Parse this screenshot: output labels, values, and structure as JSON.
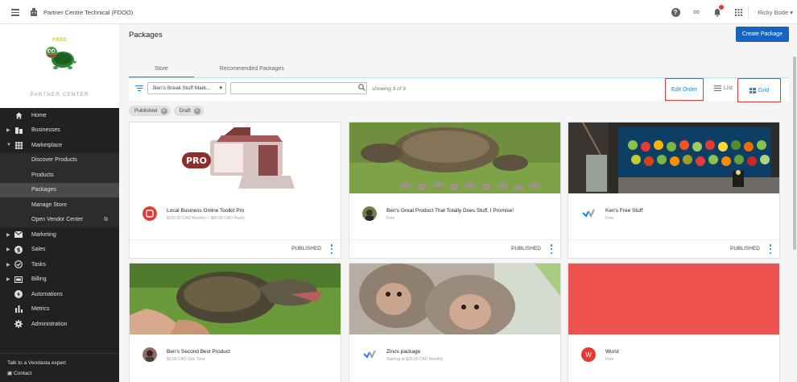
{
  "topbar": {
    "org_name": "Partner Centre Technical (FDOO)",
    "user_name": "Ricky Bode ▾",
    "icons": [
      "menu-icon",
      "building-icon",
      "help-icon",
      "infinity-icon",
      "bell-icon",
      "apps-icon"
    ]
  },
  "sidebar": {
    "partner_center": "PARTNER CENTER",
    "items": [
      {
        "label": "Home",
        "icon": "home-icon"
      },
      {
        "label": "Businesses",
        "icon": "business-icon"
      },
      {
        "label": "Marketplace",
        "icon": "grid-icon"
      },
      {
        "label": "Discover Products"
      },
      {
        "label": "Products"
      },
      {
        "label": "Packages"
      },
      {
        "label": "Manage Store"
      },
      {
        "label": "Open Vendor Center"
      },
      {
        "label": "Marketing",
        "icon": "mail-icon"
      },
      {
        "label": "Sales",
        "icon": "dollar-icon"
      },
      {
        "label": "Tasks",
        "icon": "check-icon"
      },
      {
        "label": "Billing",
        "icon": "billing-icon"
      },
      {
        "label": "Automations",
        "icon": "bolt-icon"
      },
      {
        "label": "Metrics",
        "icon": "bar-chart-icon"
      },
      {
        "label": "Administration",
        "icon": "gear-icon"
      }
    ],
    "talk": "Talk to a Vendasta expert",
    "contact": "Contact"
  },
  "main": {
    "title": "Packages",
    "create_button": "Create Package",
    "tabs": [
      {
        "label": "Store"
      },
      {
        "label": "Recommended Packages"
      }
    ],
    "store_select": "Ben's Break Stuff Mark...",
    "search_placeholder": "",
    "showing": "showing 9 of 9",
    "edit_order": "Edit Order",
    "list_label": "List",
    "grid_label": "Grid",
    "chips": [
      {
        "label": "Published"
      },
      {
        "label": "Draft"
      }
    ]
  },
  "cards": [
    {
      "name": "Local Business Online Toolkit Pro",
      "price": "$230.00 CAD Monthly + $85.00 CAD Yearly",
      "status": "PUBLISHED"
    },
    {
      "name": "Ben's Great Product That Totally Does Stuff, I Promise!",
      "price": "Free",
      "status": "PUBLISHED"
    },
    {
      "name": "Ken's Free Stuff",
      "price": "Free",
      "status": "PUBLISHED"
    },
    {
      "name": "Ben's Second Best Product",
      "price": "$3.00 CAD One Time",
      "status": ""
    },
    {
      "name": "Zinos package",
      "price": "Starting at $20.00 CAD Monthly",
      "status": ""
    },
    {
      "name": "Wurst",
      "price": "Free",
      "avatar_letter": "W",
      "status": ""
    }
  ],
  "colors": {
    "accent": "#1e88e5",
    "primary_button": "#1565c0",
    "sidebar": "#212121",
    "highlight": "#e53935",
    "wurst_banner": "#ef5350"
  }
}
